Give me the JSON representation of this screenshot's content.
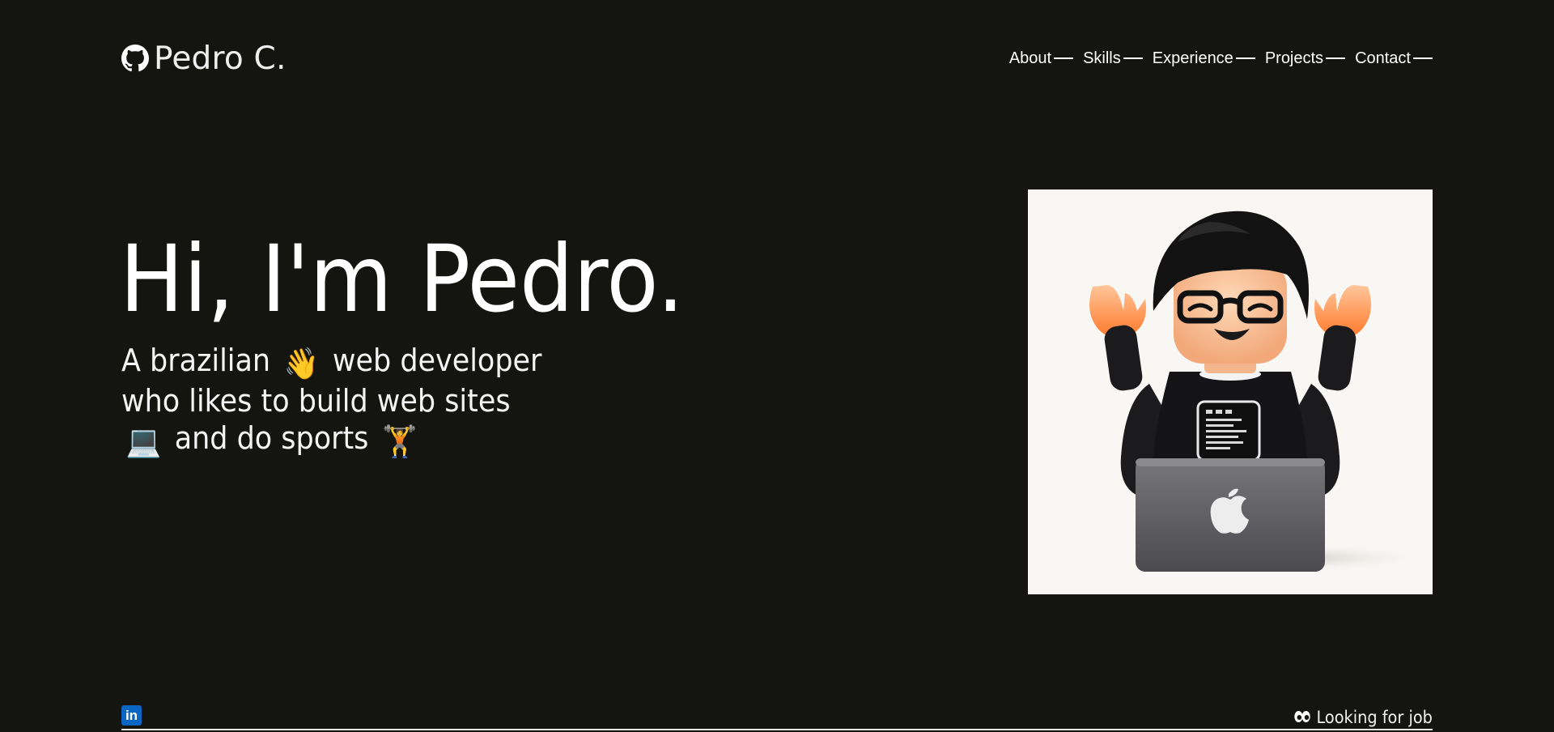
{
  "header": {
    "brand_name": "Pedro C.",
    "brand_icon": "github-icon",
    "nav": [
      {
        "label": "About"
      },
      {
        "label": "Skills"
      },
      {
        "label": "Experience"
      },
      {
        "label": "Projects"
      },
      {
        "label": "Contact"
      }
    ]
  },
  "hero": {
    "title": "Hi, I'm Pedro.",
    "subtitle": {
      "line1_a": "A brazilian",
      "line1_emoji": "👋",
      "line1_b": "web developer",
      "line2": "who likes to build web sites",
      "line3_emoji_a": "💻",
      "line3_text": "and do sports",
      "line3_emoji_b": "🏋️"
    }
  },
  "footer": {
    "linkedin_icon": "linkedin-icon",
    "linkedin_glyph": "in",
    "status_icon": "eyes-icon",
    "status_text": "Looking for job"
  },
  "colors": {
    "background": "#141410",
    "text": "#ffffff",
    "linkedin": "#0a66c2",
    "avatar_bg": "#f8f7f3"
  }
}
